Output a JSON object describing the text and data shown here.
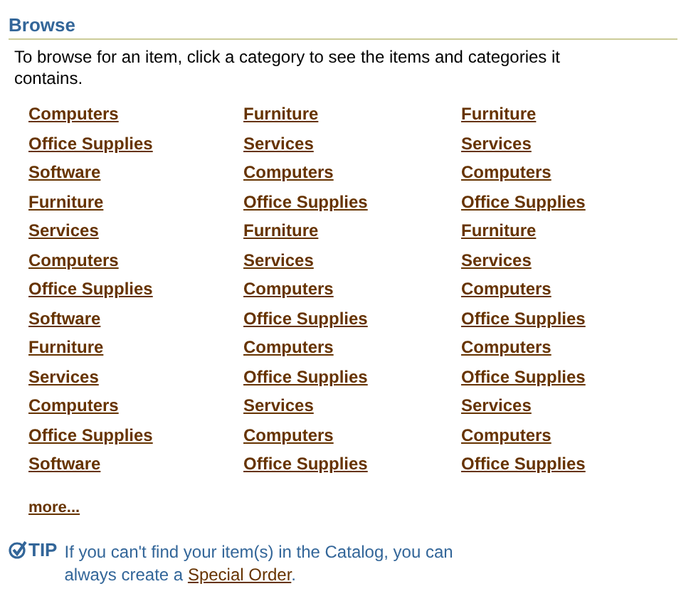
{
  "heading": "Browse",
  "intro": "To browse for an item, click a category to see the items and categories it contains.",
  "categories": [
    [
      "Computers",
      "Furniture",
      "Furniture"
    ],
    [
      "Office Supplies",
      "Services",
      "Services"
    ],
    [
      "Software",
      "Computers",
      "Computers"
    ],
    [
      "Furniture",
      "Office Supplies",
      "Office Supplies"
    ],
    [
      "Services",
      "Furniture",
      "Furniture"
    ],
    [
      "Computers",
      "Services",
      "Services"
    ],
    [
      "Office Supplies",
      "Computers",
      "Computers"
    ],
    [
      "Software",
      "Office Supplies",
      "Office Supplies"
    ],
    [
      "Furniture",
      "Computers",
      "Computers"
    ],
    [
      "Services",
      "Office Supplies",
      "Office Supplies"
    ],
    [
      "Computers",
      "Services",
      "Services"
    ],
    [
      "Office Supplies",
      "Computers",
      "Computers"
    ],
    [
      "Software",
      "Office Supplies",
      "Office Supplies"
    ]
  ],
  "more_link": "more...",
  "tip": {
    "label": "TIP",
    "text": "If you can't find your item(s) in the Catalog, you can always create a ",
    "link": "Special Order",
    "after": "."
  }
}
